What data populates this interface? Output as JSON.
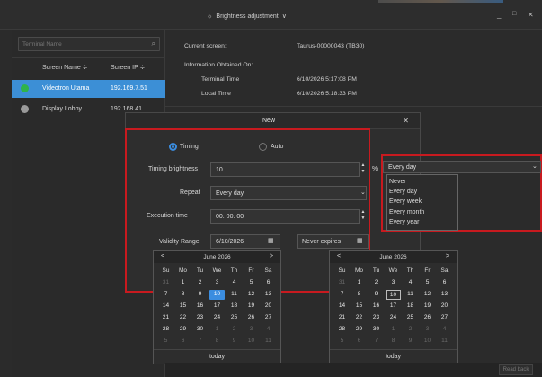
{
  "window": {
    "title": "Brightness adjustment",
    "minimize": "_",
    "maximize": "□",
    "close": "✕"
  },
  "sidebar": {
    "search_placeholder": "Terminal Name",
    "col_screen_name": "Screen Name ≑",
    "col_screen_ip": "Screen IP ≑",
    "rows": [
      {
        "name": "Videotron Utama",
        "ip": "192.169.7.51",
        "status_color": "#2fb34a"
      },
      {
        "name": "Display Lobby",
        "ip": "192.168.41",
        "status_color": "#9a9a9a"
      }
    ]
  },
  "info": {
    "current_screen_label": "Current screen:",
    "current_screen_value": "Taurus-00000043 (TB30)",
    "obtained_label": "Information Obtained On:",
    "terminal_time_label": "Terminal Time",
    "terminal_time_value": "6/10/2026 5:17:08 PM",
    "local_time_label": "Local Time",
    "local_time_value": "6/10/2026 5:18:33 PM"
  },
  "dialog": {
    "title": "New",
    "mode_timing": "Timing",
    "mode_auto": "Auto",
    "timing_brightness_label": "Timing brightness",
    "timing_brightness_value": "10",
    "percent": "%",
    "repeat_label": "Repeat",
    "repeat_value": "Every day",
    "execution_time_label": "Execution time",
    "execution_time_value": "00: 00: 00",
    "validity_label": "Validity Range",
    "validity_start": "6/10/2026",
    "validity_sep": "~",
    "validity_end": "Never expires"
  },
  "repeat_dropdown": {
    "selected": "Every day",
    "options": [
      "Never",
      "Every day",
      "Every week",
      "Every month",
      "Every year"
    ]
  },
  "calendar": {
    "month": "June 2026",
    "weekdays": [
      "Su",
      "Mo",
      "Tu",
      "We",
      "Th",
      "Fr",
      "Sa"
    ],
    "weeks": [
      [
        "31",
        "1",
        "2",
        "3",
        "4",
        "5",
        "6"
      ],
      [
        "7",
        "8",
        "9",
        "10",
        "11",
        "12",
        "13"
      ],
      [
        "14",
        "15",
        "16",
        "17",
        "18",
        "19",
        "20"
      ],
      [
        "21",
        "22",
        "23",
        "24",
        "25",
        "26",
        "27"
      ],
      [
        "28",
        "29",
        "30",
        "1",
        "2",
        "3",
        "4"
      ],
      [
        "5",
        "6",
        "7",
        "8",
        "9",
        "10",
        "11"
      ]
    ],
    "today_label": "today",
    "prev": "<",
    "next": ">"
  },
  "bottom": {
    "read_back": "Read back"
  },
  "colors": {
    "accent": "#3b8de0",
    "highlight": "#c81a1f",
    "selected_row": "#3c8fd6"
  }
}
